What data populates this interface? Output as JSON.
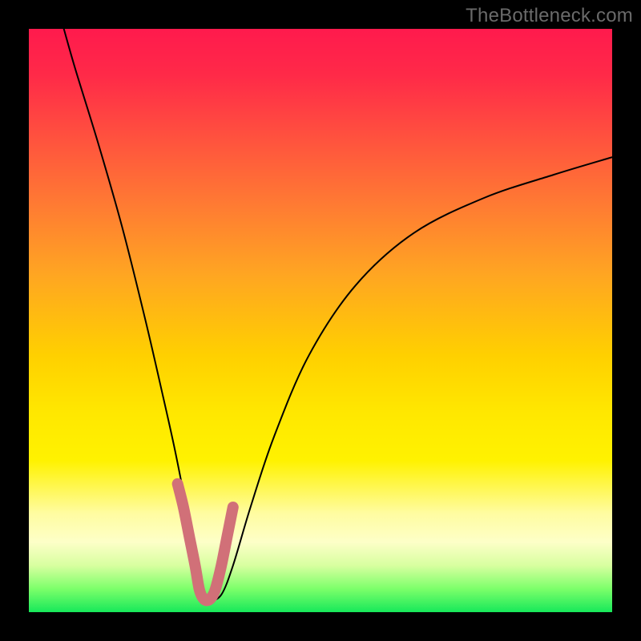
{
  "watermark": "TheBottleneck.com",
  "chart_data": {
    "type": "line",
    "title": "",
    "xlabel": "",
    "ylabel": "",
    "xlim": [
      0,
      100
    ],
    "ylim": [
      0,
      100
    ],
    "series": [
      {
        "name": "bottleneck-curve",
        "x": [
          6,
          8,
          12,
          16,
          20,
          23,
          25,
          27,
          29,
          30,
          31,
          33,
          35,
          38,
          42,
          48,
          56,
          66,
          78,
          90,
          100
        ],
        "values": [
          100,
          93,
          80,
          66,
          50,
          37,
          28,
          18,
          8,
          3,
          2,
          3,
          8,
          18,
          30,
          44,
          56,
          65,
          71,
          75,
          78
        ]
      }
    ],
    "highlight": {
      "name": "bottom-u-highlight",
      "color": "#d17078",
      "x": [
        25.5,
        26.5,
        27.5,
        28.5,
        29.2,
        29.8,
        30.5,
        31.3,
        32.0,
        33.0,
        34.0,
        35.0
      ],
      "values": [
        22,
        18,
        13,
        8,
        4,
        2.5,
        2,
        2.5,
        4,
        8,
        13,
        18
      ]
    },
    "background_gradient": {
      "stops": [
        {
          "pos": 0,
          "color": "#ff1a4d"
        },
        {
          "pos": 8,
          "color": "#ff2a48"
        },
        {
          "pos": 18,
          "color": "#ff4f3f"
        },
        {
          "pos": 30,
          "color": "#ff7a33"
        },
        {
          "pos": 42,
          "color": "#ffa522"
        },
        {
          "pos": 56,
          "color": "#ffd000"
        },
        {
          "pos": 66,
          "color": "#ffe800"
        },
        {
          "pos": 74,
          "color": "#fff200"
        },
        {
          "pos": 83,
          "color": "#fffca0"
        },
        {
          "pos": 88,
          "color": "#fdffc8"
        },
        {
          "pos": 92,
          "color": "#d8ffa0"
        },
        {
          "pos": 96,
          "color": "#7cff6a"
        },
        {
          "pos": 100,
          "color": "#17e85a"
        }
      ]
    }
  }
}
